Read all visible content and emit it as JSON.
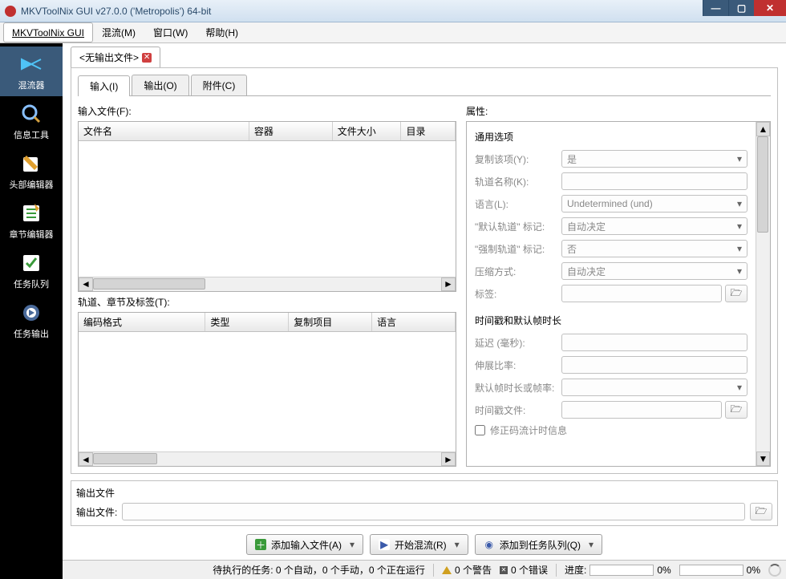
{
  "title": "MKVToolNix GUI v27.0.0 ('Metropolis') 64-bit",
  "menu": {
    "app": "MKVToolNix GUI",
    "mux": "混流(M)",
    "window": "窗口(W)",
    "help": "帮助(H)"
  },
  "sidebar": {
    "items": [
      {
        "label": "混流器"
      },
      {
        "label": "信息工具"
      },
      {
        "label": "头部编辑器"
      },
      {
        "label": "章节编辑器"
      },
      {
        "label": "任务队列"
      },
      {
        "label": "任务输出"
      }
    ]
  },
  "fileTab": {
    "title": "<无输出文件>"
  },
  "innerTabs": {
    "input": "输入(I)",
    "output": "输出(O)",
    "attachments": "附件(C)"
  },
  "left": {
    "inputFilesLabel": "输入文件(F):",
    "filesCols": {
      "name": "文件名",
      "container": "容器",
      "size": "文件大小",
      "dir": "目录"
    },
    "tracksLabel": "轨道、章节及标签(T):",
    "tracksCols": {
      "codec": "编码格式",
      "type": "类型",
      "copy": "复制项目",
      "lang": "语言"
    }
  },
  "right": {
    "propsLabel": "属性:",
    "general": {
      "header": "通用选项",
      "copyItem": {
        "label": "复制该项(Y):",
        "value": "是"
      },
      "trackName": {
        "label": "轨道名称(K):"
      },
      "language": {
        "label": "语言(L):",
        "value": "Undetermined (und)"
      },
      "defaultFlag": {
        "label": "\"默认轨道\" 标记:",
        "value": "自动决定"
      },
      "forcedFlag": {
        "label": "\"强制轨道\" 标记:",
        "value": "否"
      },
      "compression": {
        "label": "压缩方式:",
        "value": "自动决定"
      },
      "tags": {
        "label": "标签:"
      }
    },
    "timing": {
      "header": "时间戳和默认帧时长",
      "delay": {
        "label": "延迟 (毫秒):"
      },
      "stretch": {
        "label": "伸展比率:"
      },
      "defaultDur": {
        "label": "默认帧时长或帧率:"
      },
      "tsFile": {
        "label": "时间戳文件:"
      },
      "fixTiming": {
        "label": "修正码流计时信息"
      }
    }
  },
  "output": {
    "sectionLabel": "输出文件",
    "fieldLabel": "输出文件:"
  },
  "actions": {
    "addFiles": "添加输入文件(A)",
    "startMux": "开始混流(R)",
    "addToQueue": "添加到任务队列(Q)"
  },
  "status": {
    "pending": "待执行的任务: 0 个自动，0 个手动，0 个正在运行",
    "warnings": "0 个警告",
    "errors": "0 个错误",
    "progress": "进度:",
    "pct": "0%"
  }
}
